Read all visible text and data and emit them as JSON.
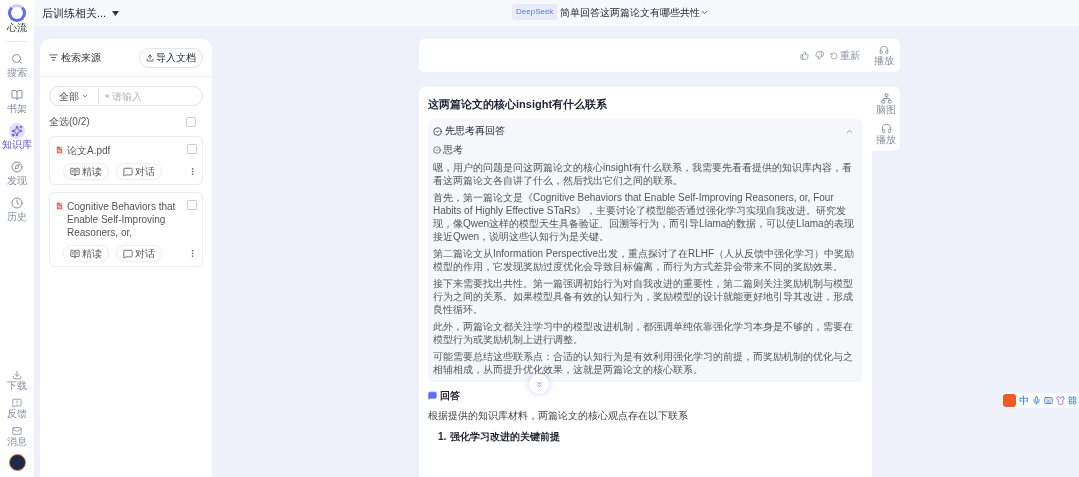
{
  "app": {
    "logo_label": "心流"
  },
  "nav": [
    {
      "kind": "search",
      "label": "搜索",
      "selected": false
    },
    {
      "kind": "library",
      "label": "书架",
      "selected": false
    },
    {
      "kind": "kb",
      "label": "知识库",
      "selected": true
    },
    {
      "kind": "discover",
      "label": "发现",
      "selected": false
    },
    {
      "kind": "history",
      "label": "历史",
      "selected": false
    }
  ],
  "nav_bottom": [
    {
      "kind": "download",
      "label": "下载"
    },
    {
      "kind": "feedback",
      "label": "反馈"
    },
    {
      "kind": "message",
      "label": "消息"
    }
  ],
  "header": {
    "workspace": "后训练相关...",
    "model": "DeepSeek",
    "title": "简单回答这两篇论文有哪些共性"
  },
  "sources": {
    "title": "检索来源",
    "import": "导入文档",
    "filter": "全部",
    "placeholder": "请输入",
    "select_all": "全选(0/2)",
    "select_all_checked": false,
    "documents": [
      {
        "name": "论文A.pdf",
        "checked": false,
        "actions": [
          {
            "kind": "read",
            "label": "精读"
          },
          {
            "kind": "chat",
            "label": "对话"
          }
        ]
      },
      {
        "name": "Cognitive Behaviors that Enable Self-Improving Reasoners, or,",
        "checked": false,
        "actions": [
          {
            "kind": "read",
            "label": "精读"
          },
          {
            "kind": "chat",
            "label": "对话"
          }
        ]
      }
    ]
  },
  "prev_message": {
    "regenerate": "重新",
    "play": "播放"
  },
  "message": {
    "question": "这两篇论文的核心insight有什么联系",
    "side_actions": [
      {
        "kind": "mindmap",
        "label": "脑图"
      },
      {
        "kind": "play",
        "label": "播放"
      }
    ],
    "thinking": {
      "title": "先思考再回答",
      "expanded": true,
      "subtitle": "思考",
      "paragraphs": [
        "嗯，用户的问题是问这两篇论文的核心insight有什么联系，我需要先看看提供的知识库内容，看看这两篇论文各自讲了什么，然后找出它们之间的联系。",
        "首先，第一篇论文是《Cognitive Behaviors that Enable Self-Improving Reasoners, or, Four Habits of Highly Effective STaRs》，主要讨论了模型能否通过强化学习实现自我改进。研究发现，像Qwen这样的模型天生具备验证、回溯等行为，而引导Llama的数据，可以使Llama的表现接近Qwen，说明这些认知行为是关键。",
        "第二篇论文从Information Perspective出发，重点探讨了在RLHF（人从反馈中强化学习）中奖励模型的作用，它发现奖励过度优化会导致目标偏离，而行为方式差异会带来不同的奖励效果。",
        "接下来需要找出共性。第一篇强调初始行为对自我改进的重要性，第二篇则关注奖励机制与模型行为之间的关系。如果模型具备有效的认知行为，奖励模型的设计就能更好地引导其改进，形成良性循环。",
        "此外，两篇论文都关注学习中的模型改进机制，都强调单纯依靠强化学习本身是不够的，需要在模型行为或奖励机制上进行调整。",
        "可能需要总结这些联系点：合适的认知行为是有效利用强化学习的前提，而奖励机制的优化与之相辅相成，从而提升优化效果，这就是两篇论文的核心联系。"
      ]
    },
    "answer": {
      "title": "回答",
      "intro": "根据提供的知识库材料，两篇论文的核心观点存在以下联系",
      "points": [
        {
          "number": "1.",
          "text": "强化学习改进的关键前提"
        }
      ]
    }
  },
  "ime": {
    "mode": "中"
  }
}
